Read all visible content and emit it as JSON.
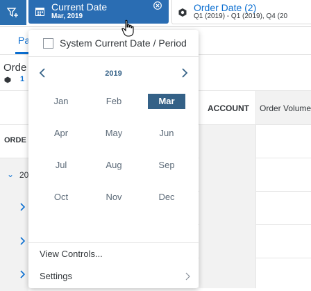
{
  "header": {
    "current_date_chip": {
      "title": "Current Date",
      "subtitle": "Mar, 2019"
    },
    "order_date_chip": {
      "title": "Order Date (2)",
      "subtitle": "Q1 (2019) - Q1 (2019), Q4 (20"
    }
  },
  "tabs": {
    "active_partial": "Pa"
  },
  "table": {
    "title_partial": "Orde",
    "subtitle_num": "1",
    "account_header": "ACCOUNT",
    "order_volume_header": "Order Volume",
    "row_header_partial": "ORDE",
    "year_row_partial": "20"
  },
  "popover": {
    "system_option_label": "System Current Date / Period",
    "year": "2019",
    "months": [
      "Jan",
      "Feb",
      "Mar",
      "Apr",
      "May",
      "Jun",
      "Jul",
      "Aug",
      "Sep",
      "Oct",
      "Nov",
      "Dec"
    ],
    "selected_month": "Mar",
    "view_controls": "View Controls...",
    "settings": "Settings"
  },
  "colors": {
    "accent_blue": "#0a6ed1",
    "chip_blue": "#2a6db3",
    "selected_month_bg": "#346187"
  }
}
